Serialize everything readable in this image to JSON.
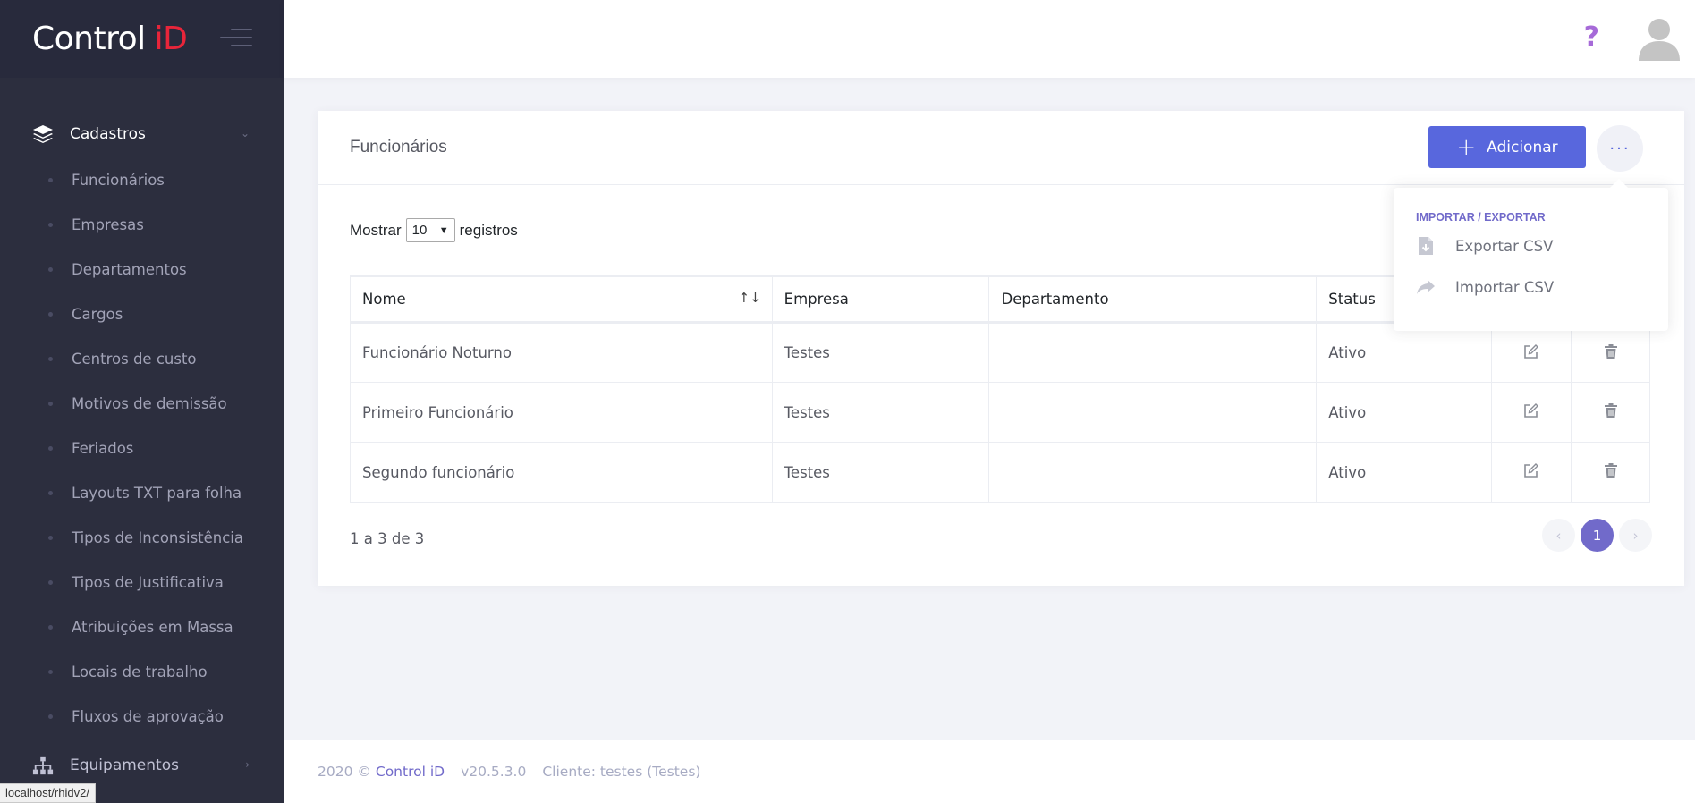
{
  "brand": {
    "name_part1": "Control",
    "name_part2": "iD"
  },
  "sidebar": {
    "section": {
      "label": "Cadastros",
      "icon": "layers-icon"
    },
    "items": [
      {
        "label": "Funcionários"
      },
      {
        "label": "Empresas"
      },
      {
        "label": "Departamentos"
      },
      {
        "label": "Cargos"
      },
      {
        "label": "Centros de custo"
      },
      {
        "label": "Motivos de demissão"
      },
      {
        "label": "Feriados"
      },
      {
        "label": "Layouts TXT para folha"
      },
      {
        "label": "Tipos de Inconsistência"
      },
      {
        "label": "Tipos de Justificativa"
      },
      {
        "label": "Atribuições em Massa"
      },
      {
        "label": "Locais de trabalho"
      },
      {
        "label": "Fluxos de aprovação"
      }
    ],
    "section2": {
      "label": "Equipamentos",
      "icon": "sitemap-icon"
    }
  },
  "status_url": "localhost/rhidv2/",
  "header": {
    "help": "?"
  },
  "page": {
    "title": "Funcionários",
    "add_label": "Adicionar",
    "more_label": "···",
    "show_prefix": "Mostrar",
    "show_value": "10",
    "show_suffix": "registros"
  },
  "table": {
    "columns": [
      "Nome",
      "Empresa",
      "Departamento",
      "Status"
    ],
    "rows": [
      {
        "nome": "Funcionário Noturno",
        "empresa": "Testes",
        "departamento": "",
        "status": "Ativo"
      },
      {
        "nome": "Primeiro Funcionário",
        "empresa": "Testes",
        "departamento": "",
        "status": "Ativo"
      },
      {
        "nome": "Segundo funcionário",
        "empresa": "Testes",
        "departamento": "",
        "status": "Ativo"
      }
    ],
    "info": "1 a 3 de 3",
    "current_page": "1"
  },
  "dropdown": {
    "header": "Importar / Exportar",
    "items": [
      {
        "label": "Exportar CSV",
        "icon": "file-download-icon"
      },
      {
        "label": "Importar CSV",
        "icon": "share-icon"
      }
    ]
  },
  "footer": {
    "year": "2020 ©",
    "brand": "Control iD",
    "version": "v20.5.3.0",
    "client": "Cliente: testes (Testes)"
  },
  "colors": {
    "sidebar": "#2c2e3e",
    "accent": "#5867dd",
    "brand_red": "#e8253a",
    "purple": "#716aca"
  }
}
